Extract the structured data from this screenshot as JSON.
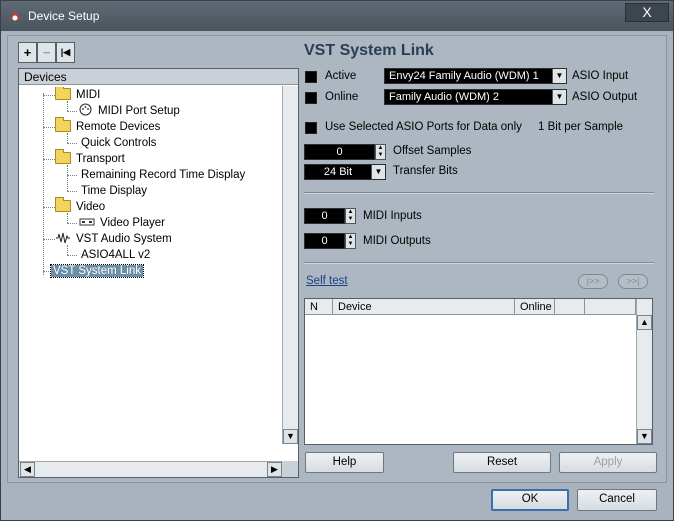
{
  "window": {
    "title": "Device Setup",
    "close_label": "X"
  },
  "toolbar": {
    "add": "+",
    "remove": "−",
    "reset": "|◀"
  },
  "devices": {
    "header": "Devices",
    "items": [
      {
        "label": "MIDI"
      },
      {
        "label": "MIDI Port Setup"
      },
      {
        "label": "Remote Devices"
      },
      {
        "label": "Quick Controls"
      },
      {
        "label": "Transport"
      },
      {
        "label": "Remaining Record Time Display"
      },
      {
        "label": "Time Display"
      },
      {
        "label": "Video"
      },
      {
        "label": "Video Player"
      },
      {
        "label": "VST Audio System"
      },
      {
        "label": "ASIO4ALL v2"
      },
      {
        "label": "VST System Link"
      }
    ]
  },
  "panel": {
    "title": "VST System Link",
    "active_label": "Active",
    "online_label": "Online",
    "asio_input_value": "Envy24 Family Audio (WDM) 1",
    "asio_input_label": "ASIO Input",
    "asio_output_value": "Family Audio (WDM) 2",
    "asio_output_label": "ASIO Output",
    "use_selected_label": "Use Selected ASIO Ports for Data only",
    "bit_per_sample": "1 Bit per Sample",
    "offset_value": "0",
    "offset_label": "Offset Samples",
    "transfer_bits_value": "24 Bit",
    "transfer_bits_label": "Transfer Bits",
    "midi_inputs_value": "0",
    "midi_inputs_label": "MIDI Inputs",
    "midi_outputs_value": "0",
    "midi_outputs_label": "MIDI Outputs",
    "self_test": "Self test",
    "table_headers": [
      "N",
      "Device",
      "Online"
    ],
    "help": "Help",
    "reset": "Reset",
    "apply": "Apply"
  },
  "footer": {
    "ok": "OK",
    "cancel": "Cancel"
  }
}
